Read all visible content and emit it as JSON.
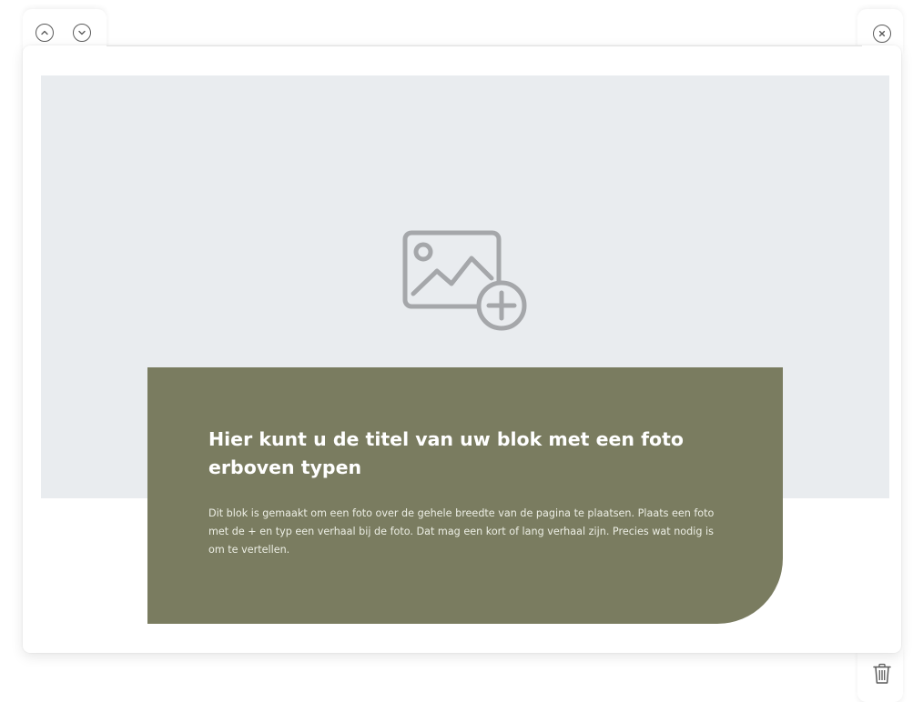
{
  "controls": {
    "move_up_icon": "chevron-up-icon",
    "move_down_icon": "chevron-down-icon",
    "close_icon": "close-icon",
    "delete_icon": "trash-icon"
  },
  "photo": {
    "placeholder_icon": "add-image-icon",
    "background": "#e9ecef"
  },
  "panel": {
    "title": "Hier kunt u de titel van uw blok met een foto erboven typen",
    "body": "Dit blok is gemaakt om een foto over de gehele breedte van de pagina te plaatsen. Plaats een foto met de + en typ een verhaal bij de foto. Dat mag een kort of lang verhaal zijn. Precies wat nodig is om te vertellen.",
    "background": "#7a7c60"
  }
}
